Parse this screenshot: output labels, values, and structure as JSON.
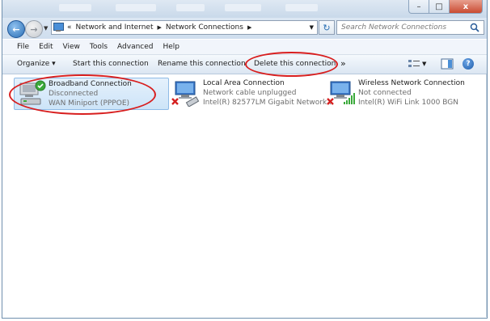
{
  "window": {
    "controls": {
      "minimize": "–",
      "maximize": "□",
      "close": "x"
    }
  },
  "nav": {
    "back_icon": "back-arrow-icon",
    "forward_icon": "forward-arrow-icon",
    "overflow": "«",
    "breadcrumbs": [
      "Network and Internet",
      "Network Connections"
    ],
    "search_placeholder": "Search Network Connections"
  },
  "menu": [
    "File",
    "Edit",
    "View",
    "Tools",
    "Advanced",
    "Help"
  ],
  "commands": {
    "organize": "Organize ▾",
    "start": "Start this connection",
    "rename": "Rename this connection",
    "delete": "Delete this connection",
    "more": "»",
    "help": "?"
  },
  "connections": [
    {
      "name": "Broadband Connection",
      "status": "Disconnected",
      "adapter": "WAN Miniport (PPPOE)",
      "icon": "broadband-modem-icon",
      "selected": true
    },
    {
      "name": "Local Area Connection",
      "status": "Network cable unplugged",
      "adapter": "Intel(R) 82577LM Gigabit Network...",
      "icon": "wired-network-icon",
      "selected": false
    },
    {
      "name": "Wireless Network Connection",
      "status": "Not connected",
      "adapter": "Intel(R) WiFi Link 1000 BGN",
      "icon": "wireless-network-icon",
      "selected": false
    }
  ],
  "colors": {
    "annotation": "#d81e1e",
    "selection": "#cde4f8",
    "status_ok": "#3aa93a",
    "status_error": "#d42020"
  }
}
